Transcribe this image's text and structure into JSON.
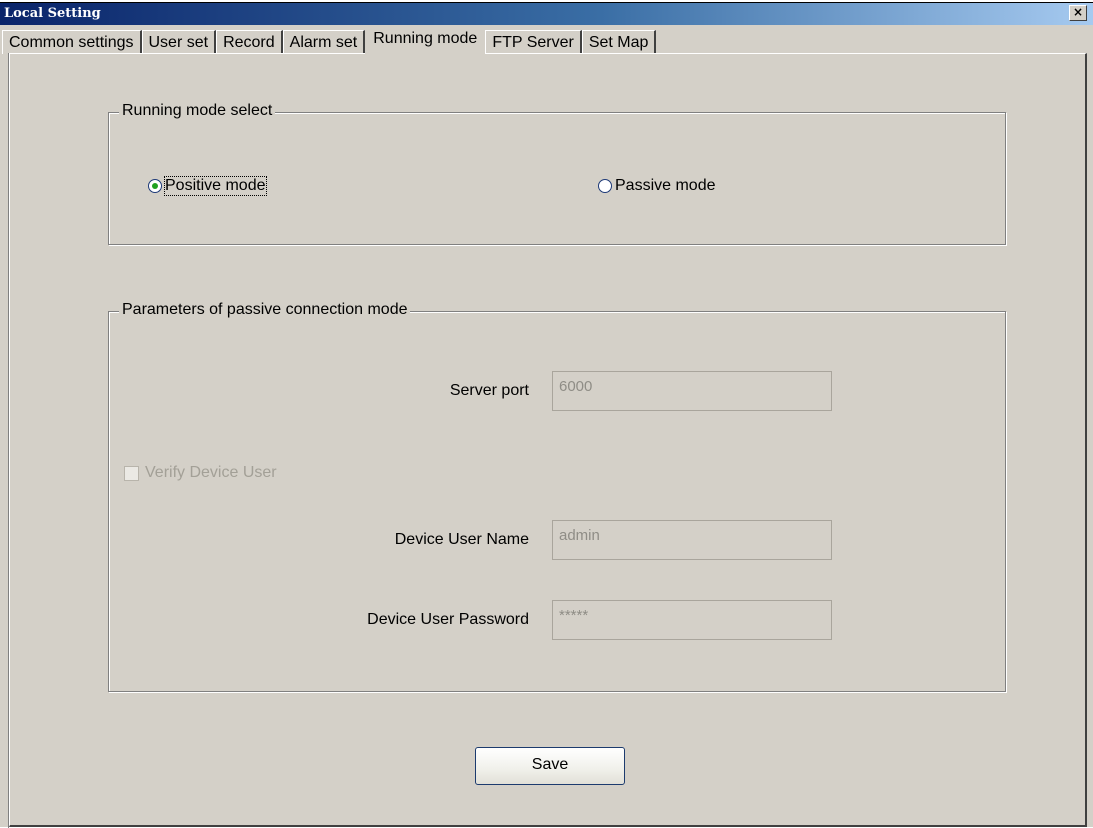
{
  "window": {
    "title": "Local Setting",
    "close_glyph": "✕"
  },
  "tabs": [
    {
      "label": "Common settings"
    },
    {
      "label": "User set"
    },
    {
      "label": "Record"
    },
    {
      "label": "Alarm set"
    },
    {
      "label": "Running mode",
      "active": true
    },
    {
      "label": "FTP Server"
    },
    {
      "label": "Set Map"
    }
  ],
  "running_mode": {
    "legend": "Running mode select",
    "positive_label": "Positive mode",
    "passive_label": "Passive  mode",
    "selected": "positive"
  },
  "passive_params": {
    "legend": "Parameters of passive connection mode",
    "server_port_label": "Server port",
    "server_port_value": "6000",
    "verify_label": "Verify Device User",
    "verify_checked": false,
    "user_name_label": "Device User Name",
    "user_name_value": "admin",
    "password_label": "Device User Password",
    "password_value": "*****"
  },
  "save_label": "Save",
  "icons": {
    "close": "close-icon",
    "radio": "radio-icon",
    "checkbox": "checkbox-icon"
  }
}
